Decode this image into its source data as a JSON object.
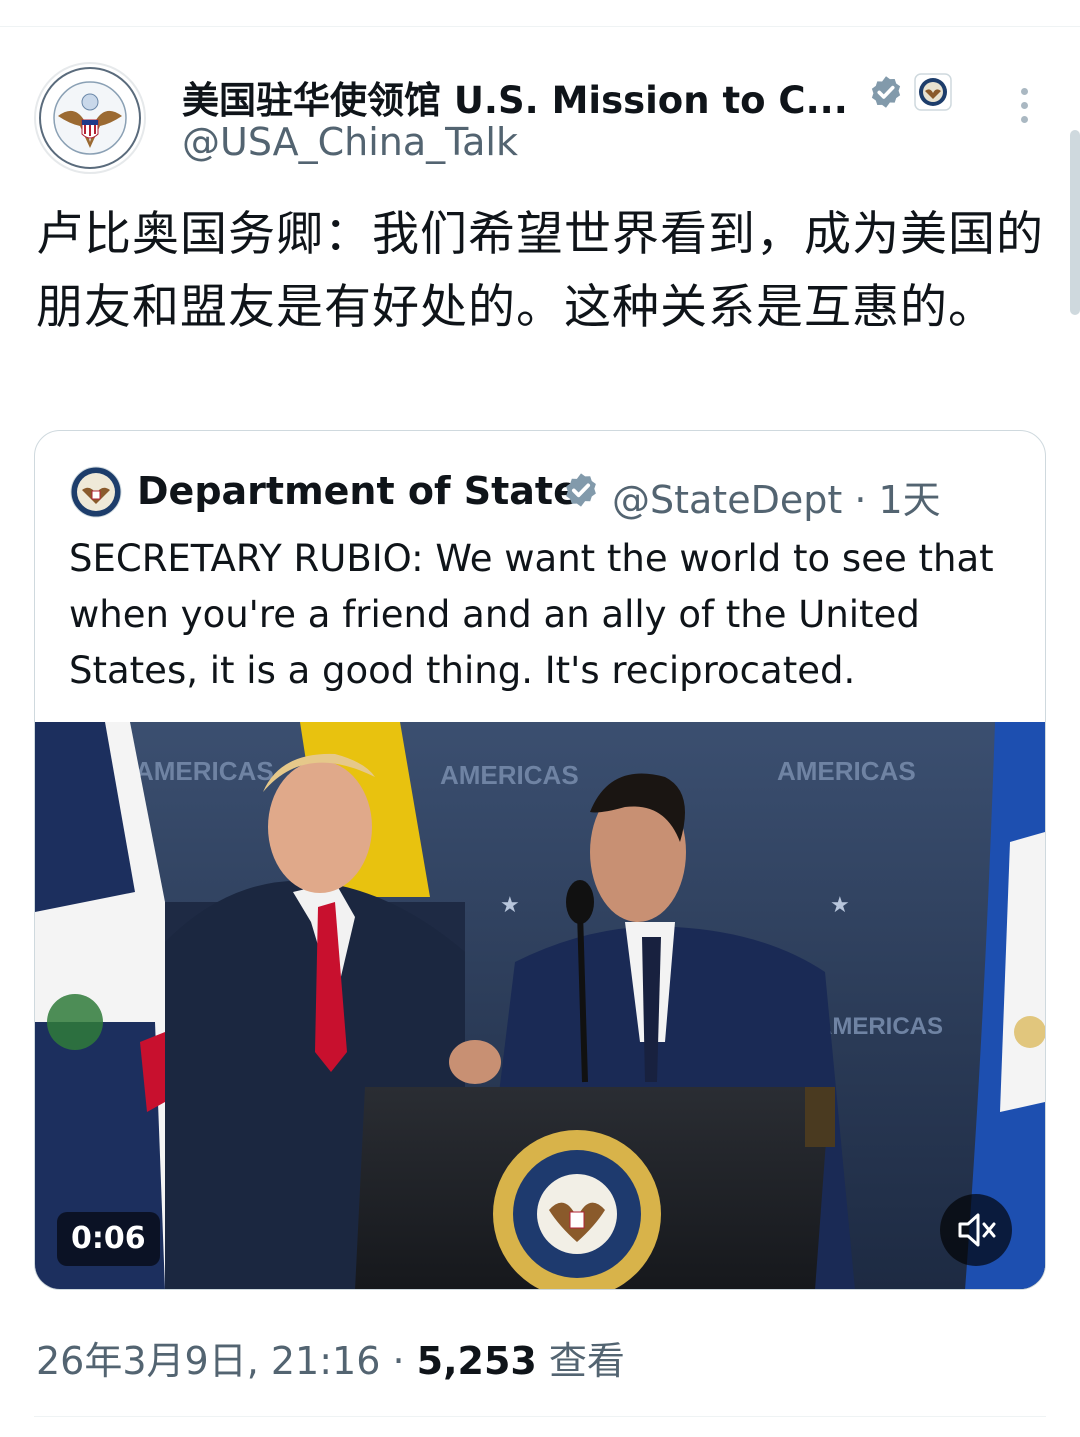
{
  "tweet": {
    "author_name": "美国驻华使领馆 U.S. Mission to C...",
    "author_handle": "@USA_China_Talk",
    "text": "卢比奥国务卿：我们希望世界看到，成为美国的朋友和盟友是有好处的。这种关系是互惠的。",
    "timestamp": "26年3月9日, 21:16",
    "separator": " · ",
    "views_count": "5,253",
    "views_label": " 查看",
    "verified_color": "#829aab",
    "text_color": "#0f1419",
    "secondary_color": "#536471"
  },
  "quote": {
    "author_name": "Department of State",
    "author_handle": "@StateDept",
    "age": " · 1天",
    "text": "SECRETARY RUBIO: We want the world to see that when you're a friend and an ally of the United States, it is a good thing. It's reciprocated.",
    "video": {
      "backdrop_text": "AMERICAS",
      "duration": "0:06",
      "mute_icon": "speaker-muted-icon"
    }
  },
  "icons": {
    "menu": "more-vertical-icon",
    "verified": "verified-badge-icon",
    "affiliation": "government-seal-icon"
  }
}
